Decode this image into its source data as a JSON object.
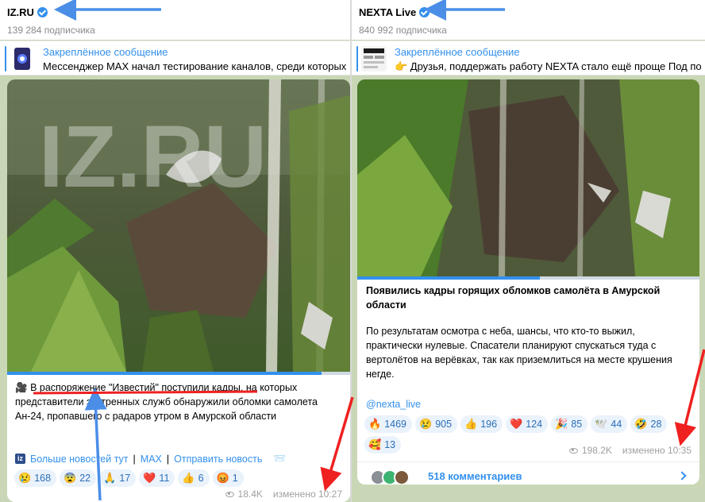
{
  "left": {
    "channel": {
      "title": "IZ.RU",
      "subscribers": "139 284 подписчика"
    },
    "pinned": {
      "title": "Закреплённое сообщение",
      "text": "Мессенджер MAX начал тестирование каналов, среди которых"
    },
    "post": {
      "watermark": "IZ.RU",
      "text_before": "В распоряжение \"Известий\" поступили кадры",
      "text_after": ", на которых представители экстренных служб обнаружили обломки самолета Ан-24, пропавшего с радаров утром в Амурской области",
      "links": {
        "more_news": "Больше новостей тут",
        "max": "MAX",
        "send_news": "Отправить новость"
      },
      "reactions": [
        {
          "emoji": "😢",
          "count": "168"
        },
        {
          "emoji": "😨",
          "count": "22"
        },
        {
          "emoji": "🙏",
          "count": "17"
        },
        {
          "emoji": "❤️",
          "count": "11"
        },
        {
          "emoji": "👍",
          "count": "6"
        },
        {
          "emoji": "😡",
          "count": "1"
        }
      ],
      "views": "18.4K",
      "edited": "изменено 10:27"
    }
  },
  "right": {
    "channel": {
      "title": "NEXTA Live",
      "subscribers": "840 992 подписчика"
    },
    "pinned": {
      "title": "Закреплённое сообщение",
      "text": "👉 Друзья, поддержать работу NEXTA стало ещё проще  Под по"
    },
    "post": {
      "headline": "Появились кадры горящих обломков самолёта в Амурской области",
      "body": "По результатам осмотра с неба, шансы, что кто-то выжил, практически нулевые. Спасатели планируют спускаться туда с вертолётов на верёвках, так как приземлиться на месте крушения негде.",
      "handle": "@nexta_live",
      "reactions": [
        {
          "emoji": "🔥",
          "count": "1469"
        },
        {
          "emoji": "😢",
          "count": "905"
        },
        {
          "emoji": "👍",
          "count": "196"
        },
        {
          "emoji": "❤️",
          "count": "124"
        },
        {
          "emoji": "🎉",
          "count": "85"
        },
        {
          "emoji": "🕊️",
          "count": "44"
        },
        {
          "emoji": "🤣",
          "count": "28"
        },
        {
          "emoji": "🥰",
          "count": "13"
        }
      ],
      "views": "198.2K",
      "edited": "изменено 10:35",
      "comments": "518 комментариев"
    }
  },
  "colors": {
    "accent": "#3390ec",
    "annotation_blue": "#4a8ee8",
    "annotation_red": "#ef2020"
  }
}
